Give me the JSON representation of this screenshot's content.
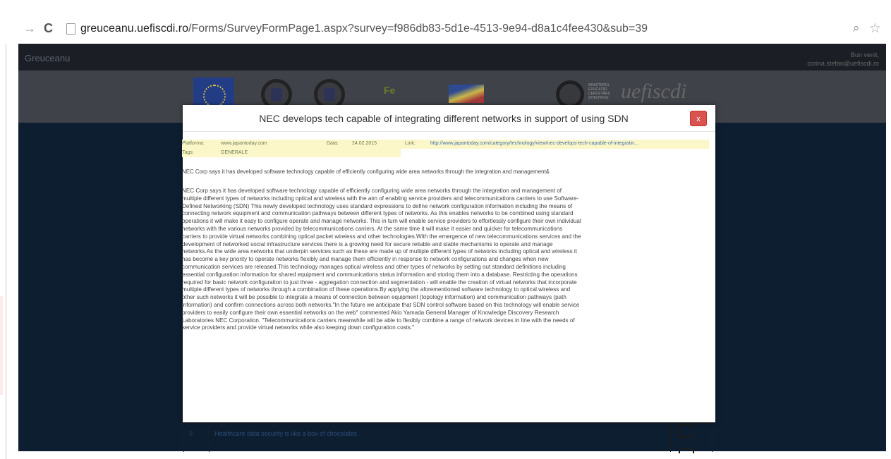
{
  "browser": {
    "url_host": "greuceanu.uefiscdi.ro",
    "url_path": "/Forms/SurveyFormPage1.aspx?survey=f986db83-5d1e-4513-9e94-d8a1c4fee430&sub=39",
    "icons": [
      "forward-icon",
      "reload-icon",
      "page-icon",
      "zoom-icon",
      "bookmark-star-icon"
    ]
  },
  "site": {
    "brand": "Greuceanu",
    "welcome_line1": "Bun venit,",
    "welcome_line2": "corina.stefan@uefiscdi.ro",
    "logo_fe": "Fe",
    "logo_minister": "MINISTERUL EDUCAȚIEI CERCETĂRII ȘTIINȚIFICE",
    "logo_uefiscdi": "UEFISCDI",
    "row_number": "9",
    "row_title": "Healthcare data security is like a box of chocolates"
  },
  "modal": {
    "title": "NEC develops tech capable of integrating different networks in support of using SDN",
    "close_label": "x",
    "platform_label": "Platforma:",
    "platform_value": "www.japantoday.com",
    "date_label": "Data:",
    "date_value": "24.02.2015",
    "link_label": "Link:",
    "link_value": "http://www.japantoday.com/category/technology/view/nec-develops-tech-capable-of-integratin...",
    "tags_label": "Tags:",
    "tags_value": "GENERALE",
    "summary": "NEC Corp says it has developed software technology capable of efficiently configuring wide area networks through the integration and management&",
    "body_lines": [
      "NEC Corp says it has developed software technology capable of efficiently configuring wide area networks through the integration and management of",
      "multiple different types of networks including optical and wireless with the aim of enabling service providers and telecommunications carriers to use Software-",
      "Defined Networking (SDN) This newly developed technology uses standard expressions to define network configuration information including the means of",
      "connecting network equipment and communication pathways between different types of networks. As this enables networks to be combined using standard",
      "operations it will make it easy to configure operate and manage networks. This in turn will enable service providers to effortlessly configure their own individual",
      "networks with the various networks provided by telecommunications carriers. At the same time it will make it easier and quicker for telecommunications",
      "carriers to provide virtual networks combining optical packet wireless and other technologies.With the emergence of new telecommunications services and the",
      "development of networked social infrastructure services there is a growing need for secure reliable and stable mechanisms to operate and manage",
      "networks.As the wide area networks that underpin services such as these are made up of multiple different types of networks including optical and wireless it",
      "has become a key priority to operate networks flexibly and manage them efficiently in response to network configurations and changes when new",
      "communication services are released.This technology manages optical wireless and other types of networks by setting out standard definitions including",
      "essential configuration information for shared equipment and communications status information and storing them into a database. Restricting the operations",
      "required for basic network configuration to just three - aggregation connection and segmentation - will enable the creation of virtual networks that incorporate",
      "multiple different types of networks through a combination of these operations.By applying the aforementioned software technology to optical wireless and",
      "other such networks it will be possible to integrate a means of connection between equipment (topology information) and communication pathways (path",
      "information) and confirm connections across both networks.\"In the future we anticipate that SDN control software based on this technology will enable service",
      "providers to easily configure their own essential networks on the web\" commented Akio Yamada General Manager of Knowledge Discovery Research",
      "Laboratories NEC Corporation. \"Telecommunications carriers meanwhile will be able to flexibly combine a range of network devices in line with the needs of",
      "service providers and provide virtual networks while also keeping down configuration costs.\""
    ]
  },
  "colors": {
    "close_button": "#d9534f",
    "meta_background": "#fcf7c9",
    "site_background": "#0e1e31",
    "link": "#3e6fa8"
  }
}
